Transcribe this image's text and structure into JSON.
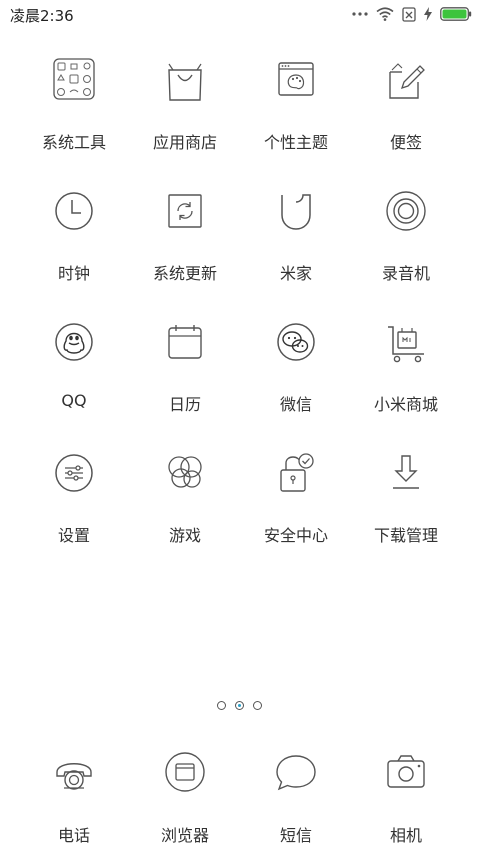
{
  "status_bar": {
    "time": "凌晨2:36",
    "battery_color": "#3dc43d"
  },
  "apps": [
    {
      "label": "系统工具",
      "icon": "folder-tools-icon"
    },
    {
      "label": "应用商店",
      "icon": "shopping-bag-icon"
    },
    {
      "label": "个性主题",
      "icon": "theme-palette-icon"
    },
    {
      "label": "便签",
      "icon": "notes-pen-icon"
    },
    {
      "label": "时钟",
      "icon": "clock-icon"
    },
    {
      "label": "系统更新",
      "icon": "system-update-icon"
    },
    {
      "label": "米家",
      "icon": "mijia-shield-icon"
    },
    {
      "label": "录音机",
      "icon": "recorder-icon"
    },
    {
      "label": "QQ",
      "icon": "qq-penguin-icon"
    },
    {
      "label": "日历",
      "icon": "calendar-icon"
    },
    {
      "label": "微信",
      "icon": "wechat-icon"
    },
    {
      "label": "小米商城",
      "icon": "mi-store-cart-icon"
    },
    {
      "label": "设置",
      "icon": "settings-sliders-icon"
    },
    {
      "label": "游戏",
      "icon": "game-circles-icon"
    },
    {
      "label": "安全中心",
      "icon": "security-lock-icon"
    },
    {
      "label": "下载管理",
      "icon": "download-icon"
    }
  ],
  "dock": [
    {
      "label": "电话",
      "icon": "phone-icon"
    },
    {
      "label": "浏览器",
      "icon": "browser-icon"
    },
    {
      "label": "短信",
      "icon": "message-bubble-icon"
    },
    {
      "label": "相机",
      "icon": "camera-icon"
    }
  ],
  "pager": {
    "pages": 3,
    "current_page": 2,
    "accent": "#2aa0c8"
  }
}
